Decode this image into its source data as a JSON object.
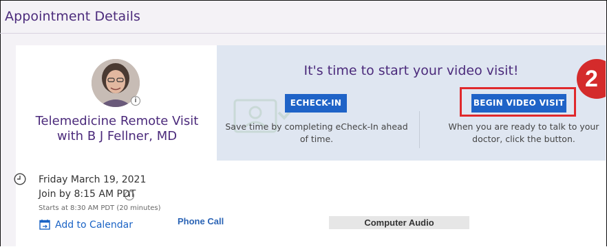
{
  "header": {
    "title": "Appointment Details"
  },
  "provider": {
    "visit_title": "Telemedicine Remote Visit with B J Fellner, MD",
    "avatar_info_symbol": "i"
  },
  "appointment": {
    "date": "Friday March 19, 2021",
    "join_by": "Join by 8:15 AM PDT",
    "join_info_symbol": "i",
    "starts_at": "Starts at 8:30 AM PDT (20 minutes)",
    "add_to_calendar": "Add to Calendar"
  },
  "panel": {
    "heading": "It's time to start your video visit!",
    "echeck_button": "ECHECK-IN",
    "echeck_desc": "Save time by completing eCheck-In ahead of time.",
    "begin_button": "BEGIN VIDEO VISIT",
    "begin_desc": "When you are ready to talk to your doctor, click the button.",
    "step_number": "2"
  },
  "audio": {
    "phone_call": "Phone Call",
    "computer_audio": "Computer Audio"
  },
  "colors": {
    "brand_purple": "#4b2a7b",
    "button_blue": "#1f63c7",
    "highlight_red": "#e0282b",
    "panel_bg": "#dfe6f1"
  },
  "icons": [
    "info-icon",
    "clock-icon",
    "calendar-icon",
    "avatar"
  ]
}
